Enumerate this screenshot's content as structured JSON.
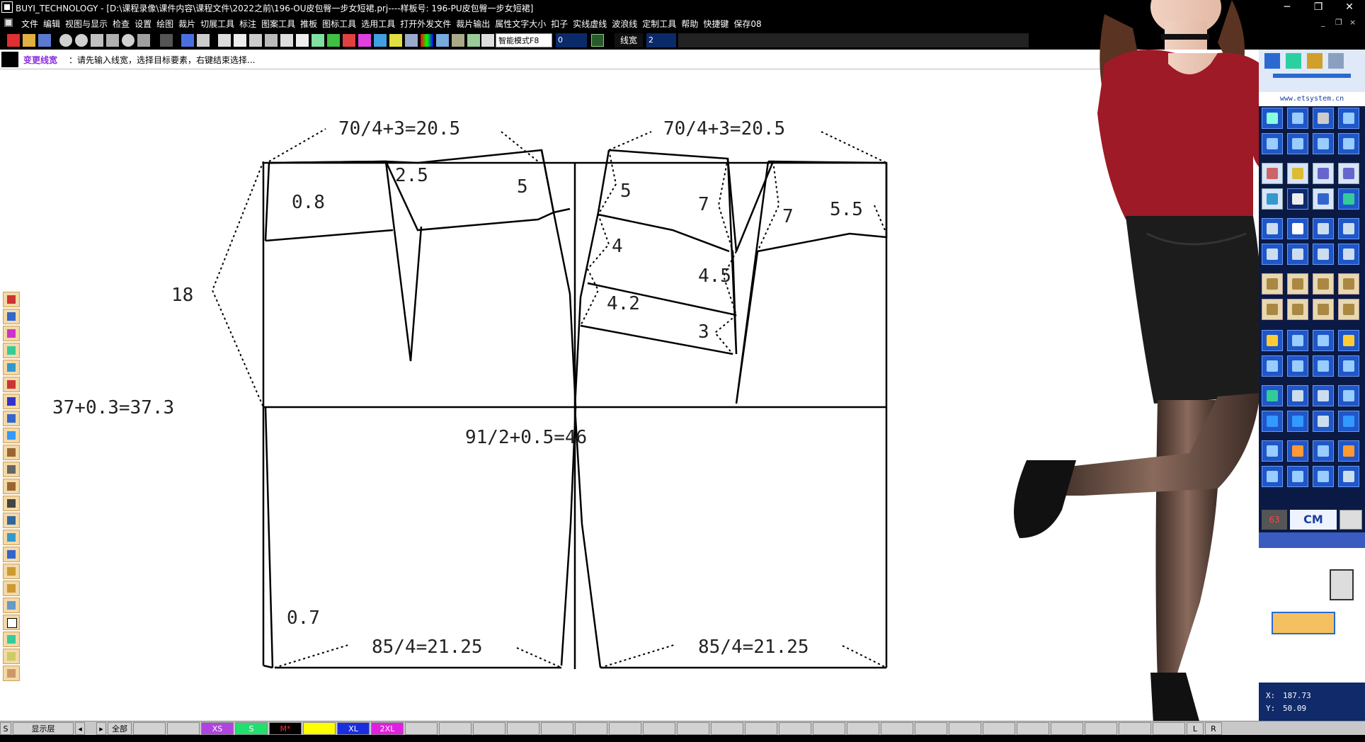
{
  "app": {
    "title": "BUYI_TECHNOLOGY - [D:\\课程录像\\课件内容\\课程文件\\2022之前\\196-OU皮包臀一步女短裙.prj----样板号: 196-PU皮包臀一步女短裙]",
    "window_controls": [
      "─",
      "❐",
      "✕"
    ],
    "mdi_controls": [
      "_",
      "❐",
      "×"
    ]
  },
  "menu": [
    "文件",
    "编辑",
    "视图与显示",
    "检查",
    "设置",
    "绘图",
    "裁片",
    "切展工具",
    "标注",
    "图案工具",
    "推板",
    "图标工具",
    "选用工具",
    "打开外发文件",
    "裁片输出",
    "属性文字大小",
    "扣子",
    "实线虚线",
    "波浪线",
    "定制工具",
    "帮助",
    "快捷键",
    "保存08"
  ],
  "toolbar": {
    "mode_select": "智能模式F8",
    "input_value": "0",
    "line_width_label": "线宽",
    "line_width_value": "2"
  },
  "prompt": {
    "command": "变更线宽",
    "message": "：请先输入线宽，选择目标要素，右键结束选择..."
  },
  "pattern": {
    "labels": {
      "waist_front": "70/4+3=20.5",
      "waist_back": "70/4+3=20.5",
      "dart_2_5": "2.5",
      "val_5_a": "5",
      "val_0_8": "0.8",
      "val_18": "18",
      "hip_side": "37+0.3=37.3",
      "hip_width": "91/2+0.5=46",
      "val_0_7": "0.7",
      "hem_front": "85/4=21.25",
      "hem_back": "85/4=21.25",
      "val_5_b": "5",
      "val_7_a": "7",
      "val_7_b": "7",
      "val_5_5": "5.5",
      "val_4": "4",
      "val_4_5": "4.5",
      "val_4_2": "4.2",
      "val_3": "3"
    }
  },
  "right_panel": {
    "url": "www.etsystem.cn",
    "unit_number": "63",
    "unit": "CM",
    "coord_x_label": "X:",
    "coord_x": "187.73",
    "coord_y_label": "Y:",
    "coord_y": "50.09"
  },
  "statusbar": {
    "s_label": "S",
    "layer_label": "显示层",
    "all_label": "全部",
    "sizes": [
      {
        "label": "XS",
        "color": "#b044e0"
      },
      {
        "label": "S",
        "color": "#22e070"
      },
      {
        "label": "M*",
        "color": "#000000",
        "text_color": "#ff3030"
      },
      {
        "label": "",
        "color": "#ffff00"
      },
      {
        "label": "XL",
        "color": "#1a2ee0"
      },
      {
        "label": "2XL",
        "color": "#e020e0"
      }
    ],
    "left_btn": "L",
    "right_btn": "R"
  },
  "colors": {
    "titlebar": "#000000",
    "prompt_command": "#8a2be2",
    "panel_blue": "#0b1a45",
    "toolbox_tan": "#f3d9a6"
  }
}
